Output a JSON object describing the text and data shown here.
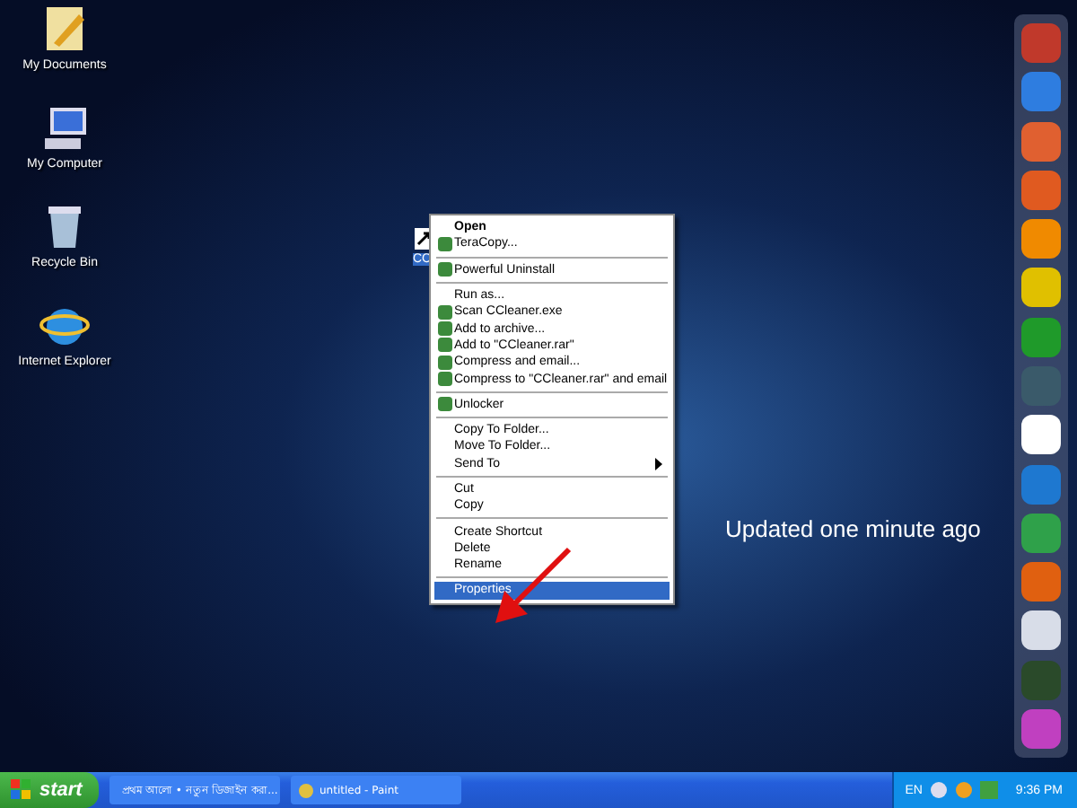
{
  "desktop_icons": [
    {
      "label": "My Documents",
      "kind": "documents",
      "selected": false
    },
    {
      "label": "My Computer",
      "kind": "computer",
      "selected": false
    },
    {
      "label": "Recycle Bin",
      "kind": "bin",
      "selected": false
    },
    {
      "label": "Internet Explorer",
      "kind": "browser",
      "selected": false
    }
  ],
  "file_icon": {
    "label": "CC",
    "selected": true
  },
  "context_menu": {
    "items": [
      {
        "kind": "item",
        "label": "Open",
        "default": true,
        "selected": false
      },
      {
        "kind": "icon_item",
        "label": "TeraCopy...",
        "default": false,
        "selected": false
      },
      {
        "kind": "separator"
      },
      {
        "kind": "icon_item",
        "label": "Powerful Uninstall",
        "default": false,
        "selected": false
      },
      {
        "kind": "separator"
      },
      {
        "kind": "item",
        "label": "Run as...",
        "default": false,
        "selected": false
      },
      {
        "kind": "icon_item",
        "label": "Scan CCleaner.exe",
        "default": false,
        "selected": false
      },
      {
        "kind": "icon_item",
        "label": "Add to archive...",
        "default": false,
        "selected": false
      },
      {
        "kind": "icon_item",
        "label": "Add to \"CCleaner.rar\"",
        "default": false,
        "selected": false
      },
      {
        "kind": "icon_item",
        "label": "Compress and email...",
        "default": false,
        "selected": false
      },
      {
        "kind": "icon_item",
        "label": "Compress to \"CCleaner.rar\" and email",
        "default": false,
        "selected": false
      },
      {
        "kind": "separator"
      },
      {
        "kind": "icon_item",
        "label": "Unlocker",
        "default": false,
        "selected": false
      },
      {
        "kind": "separator"
      },
      {
        "kind": "item",
        "label": "Copy To Folder...",
        "default": false,
        "selected": false
      },
      {
        "kind": "item",
        "label": "Move To Folder...",
        "default": false,
        "selected": false
      },
      {
        "kind": "submenu",
        "label": "Send To",
        "default": false,
        "selected": false
      },
      {
        "kind": "separator"
      },
      {
        "kind": "item",
        "label": "Cut",
        "default": false,
        "selected": false
      },
      {
        "kind": "item",
        "label": "Copy",
        "default": false,
        "selected": false
      },
      {
        "kind": "separator"
      },
      {
        "kind": "item",
        "label": "Create Shortcut",
        "default": false,
        "selected": false
      },
      {
        "kind": "item",
        "label": "Delete",
        "default": false,
        "selected": false
      },
      {
        "kind": "item",
        "label": "Rename",
        "default": false,
        "selected": false
      },
      {
        "kind": "separator"
      },
      {
        "kind": "item",
        "label": "Properties",
        "default": false,
        "selected": true
      }
    ]
  },
  "wallpaper_text": "Updated one minute ago",
  "taskbar": {
    "start_label": "start",
    "tasks": [
      {
        "label": "প্রথম আলো • নতুন ডিজাইন করা...",
        "selected": false
      },
      {
        "label": "untitled - Paint",
        "selected": false
      }
    ],
    "language": "EN",
    "clock": "9:36 PM"
  }
}
